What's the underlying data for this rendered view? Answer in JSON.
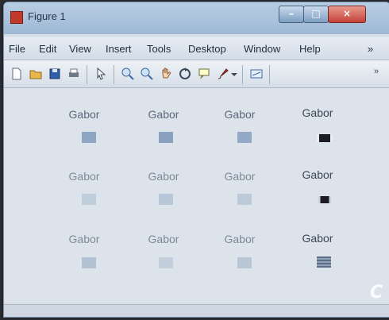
{
  "window": {
    "title": "Figure 1",
    "buttons": {
      "minimize": "–",
      "maximize": "□",
      "close": "×"
    }
  },
  "menu": {
    "items": [
      "File",
      "Edit",
      "View",
      "Insert",
      "Tools",
      "Desktop",
      "Window",
      "Help"
    ],
    "overflow": "»"
  },
  "toolbar": {
    "icons": [
      "new-figure-icon",
      "open-file-icon",
      "save-icon",
      "print-icon",
      "select-arrow-icon",
      "zoom-in-icon",
      "zoom-out-icon",
      "pan-hand-icon",
      "rotate-3d-icon",
      "data-cursor-icon",
      "brush-icon",
      "dropdown-arrow-icon",
      "link-plot-icon"
    ],
    "overflow": "»"
  },
  "figure": {
    "subplot_title": "Gabor",
    "rows": [
      [
        "Gabor",
        "Gabor",
        "Gabor",
        "Gabor"
      ],
      [
        "Gabor",
        "Gabor",
        "Gabor",
        "Gabor"
      ],
      [
        "Gabor",
        "Gabor",
        "Gabor",
        "Gabor"
      ]
    ]
  },
  "colors": {
    "thumb_blue": "#8fa6c3",
    "thumb_pale": "#b9c8d8",
    "thumb_dark": "#1c1c24"
  },
  "watermark": "C"
}
